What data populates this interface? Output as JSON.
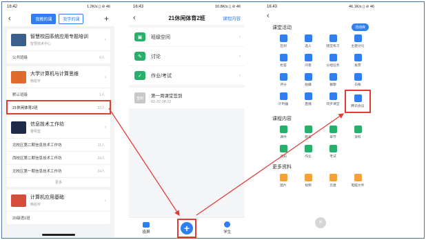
{
  "colors": {
    "accent": "#2f7ff2",
    "highlight": "#e23b35",
    "green": "#27b06b",
    "orange": "#f5a13a"
  },
  "phone1": {
    "status": {
      "time": "16:42",
      "right": "1.2K/s ▯ ⊘ 46"
    },
    "tabs": [
      "我教的课",
      "我学的课"
    ],
    "courses": [
      {
        "title": "智慧校园系统应用专题培训",
        "teacher": "智慧技术中心",
        "thumb_color": "#3a5f8a",
        "rows": [
          {
            "name": "公共班级",
            "count": "6人"
          }
        ]
      },
      {
        "title": "大学计算机与计算思维",
        "teacher": "韩柏宇",
        "thumb_color": "#e06a2e",
        "rows": [
          {
            "name": "默认班级",
            "count": "1人"
          },
          {
            "name": "21休闲体育2班",
            "count": "32人",
            "highlight": true
          }
        ]
      },
      {
        "title": "信息技术工作坊",
        "teacher": "曹明堂",
        "thumb_color": "#1e2a48",
        "rows": [
          {
            "name": "北校区第二期信息技术工作坊",
            "count": "11人"
          },
          {
            "name": "西校区第二期信息技术工作坊",
            "count": "24人"
          },
          {
            "name": "北校区第一期信息技术工作坊",
            "count": "24人"
          }
        ],
        "more": "更多"
      },
      {
        "title": "计算机应用基础",
        "teacher": "韩柏宇",
        "thumb_color": "#d84a3a",
        "rows": [
          {
            "name": "20级语1班",
            "count": ""
          }
        ]
      }
    ]
  },
  "phone2": {
    "status": {
      "time": "16:43",
      "right": "10.8K/s ▯ ⊘ 46"
    },
    "title": "21休闲体育2班",
    "link": "课程内容",
    "items": [
      "班级空间",
      "讨论",
      "作业/考试"
    ],
    "sign": {
      "badge": "签到",
      "title": "第一周课堂签到",
      "date": "02-22 08:22"
    },
    "tabbar": {
      "left": "投屏",
      "right": "学生"
    }
  },
  "phone3": {
    "status": {
      "time": "16:43",
      "right": "46.1K/s ▯ ⊘ 46"
    },
    "activity_title": "课堂活动",
    "activity_button": "活动库",
    "activities": [
      {
        "label": "签到",
        "icon": "check-icon",
        "color": "accent"
      },
      {
        "label": "选人",
        "icon": "person-icon",
        "color": "accent"
      },
      {
        "label": "随堂练习",
        "icon": "edit-icon",
        "color": "accent"
      },
      {
        "label": "主题讨论",
        "icon": "chat-icon",
        "color": "accent"
      },
      {
        "label": "抢答",
        "icon": "hand-icon",
        "color": "accent"
      },
      {
        "label": "问卷",
        "icon": "survey-icon",
        "color": "accent"
      },
      {
        "label": "分组任务",
        "icon": "group-icon",
        "color": "accent"
      },
      {
        "label": "投票",
        "icon": "poll-icon",
        "color": "accent"
      },
      {
        "label": "评分",
        "icon": "star-icon",
        "color": "accent"
      },
      {
        "label": "拍摄",
        "icon": "camera-icon",
        "color": "accent"
      },
      {
        "label": "群聊",
        "icon": "chat-group-icon",
        "color": "accent"
      },
      {
        "label": "白板",
        "icon": "whiteboard-icon",
        "color": "accent"
      },
      {
        "label": "计时器",
        "icon": "timer-icon",
        "color": "accent"
      },
      {
        "label": "直播",
        "icon": "live-icon",
        "color": "accent"
      },
      {
        "label": "同步课堂",
        "icon": "sync-icon",
        "color": "accent"
      },
      {
        "label": "腾讯会议",
        "icon": "meeting-icon",
        "color": "accent",
        "highlight": true
      }
    ],
    "content_title": "课程内容",
    "content": [
      {
        "label": "课件",
        "icon": "slides-icon",
        "color": "green"
      },
      {
        "label": "教案",
        "icon": "doc-icon",
        "color": "green"
      },
      {
        "label": "章节",
        "icon": "chapter-icon",
        "color": "green"
      },
      {
        "label": "资料",
        "icon": "folder-icon",
        "color": "green"
      },
      {
        "label": "通知",
        "icon": "notice-icon",
        "color": "green"
      },
      {
        "label": "作业",
        "icon": "homework-icon",
        "color": "green"
      },
      {
        "label": "考试",
        "icon": "exam-icon",
        "color": "green"
      }
    ],
    "more_title": "更多资料",
    "more": [
      {
        "label": "图片",
        "icon": "image-icon",
        "color": "orange"
      },
      {
        "label": "视频",
        "icon": "video-icon",
        "color": "orange"
      },
      {
        "label": "云盘",
        "icon": "cloud-icon",
        "color": "orange"
      },
      {
        "label": "电脑文件",
        "icon": "computer-icon",
        "color": "orange"
      }
    ]
  }
}
